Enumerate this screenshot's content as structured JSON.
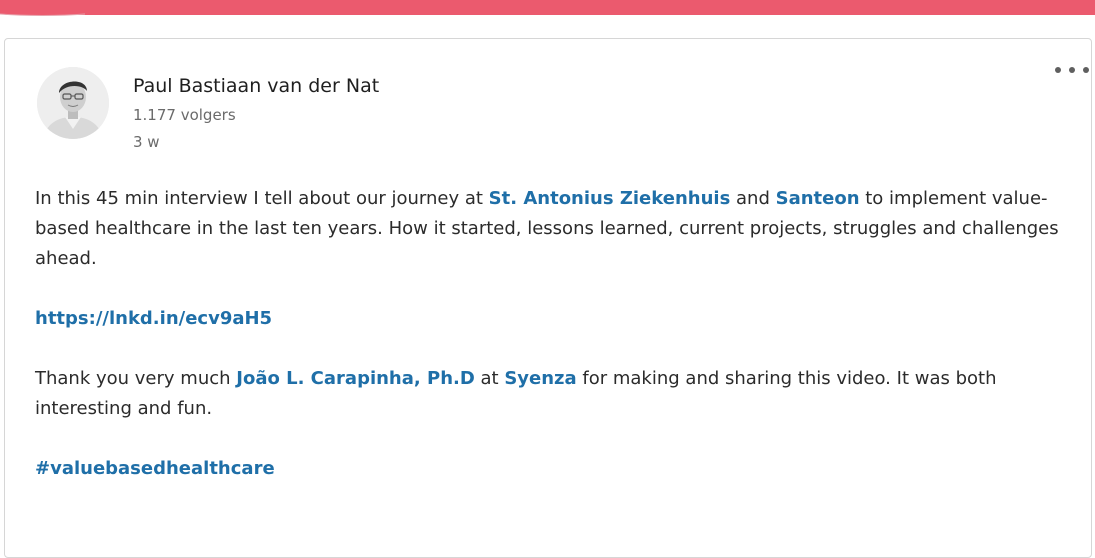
{
  "post": {
    "author_name": "Paul Bastiaan van der Nat",
    "followers": "1.177 volgers",
    "timestamp": "3 w",
    "paragraph1": {
      "t1": "In this 45 min interview I tell about our journey at ",
      "link1": "St. Antonius Ziekenhuis",
      "t2": " and ",
      "link2": "Santeon",
      "t3": " to implement value-based healthcare in the last ten years. How it started, lessons learned, current projects, struggles and challenges ahead."
    },
    "url": "https://lnkd.in/ecv9aH5",
    "paragraph2": {
      "t1": "Thank you very much ",
      "link1": "João L. Carapinha, Ph.D",
      "t2": " at ",
      "link2": "Syenza",
      "t3": " for making and sharing this video. It was both interesting and fun."
    },
    "hashtag": "#valuebasedhealthcare"
  },
  "colors": {
    "accent_band": "#eb5a6e",
    "link": "#1f6fa8",
    "text": "#2b2b2b",
    "muted": "#6b6b6b"
  },
  "icons": {
    "more": "more-horizontal-icon",
    "avatar": "person-photo"
  }
}
